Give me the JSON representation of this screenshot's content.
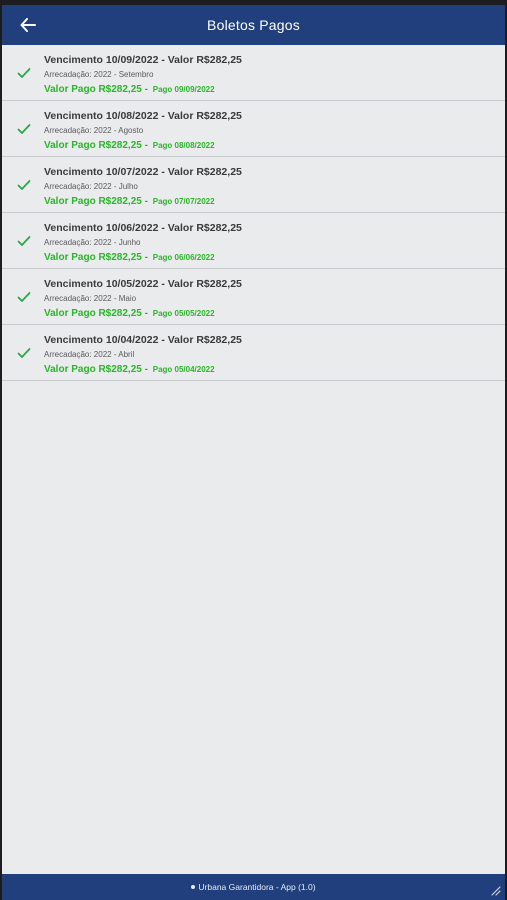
{
  "header": {
    "title": "Boletos Pagos",
    "back_icon": "arrow-left-icon"
  },
  "colors": {
    "header_bg": "#203f7c",
    "background": "#eaebed",
    "paid_green": "#2ab52a",
    "check_green": "#2aa844"
  },
  "items": [
    {
      "title": "Vencimento 10/09/2022 - Valor R$282,25",
      "subtitle": "Arrecadação: 2022 - Setembro",
      "paid_label": "Valor Pago R$282,25 -",
      "paid_date": "Pago 09/09/2022"
    },
    {
      "title": "Vencimento 10/08/2022 - Valor R$282,25",
      "subtitle": "Arrecadação: 2022 - Agosto",
      "paid_label": "Valor Pago R$282,25 -",
      "paid_date": "Pago 08/08/2022"
    },
    {
      "title": "Vencimento 10/07/2022 - Valor R$282,25",
      "subtitle": "Arrecadação: 2022 - Julho",
      "paid_label": "Valor Pago R$282,25 -",
      "paid_date": "Pago 07/07/2022"
    },
    {
      "title": "Vencimento 10/06/2022 - Valor R$282,25",
      "subtitle": "Arrecadação: 2022 - Junho",
      "paid_label": "Valor Pago R$282,25 -",
      "paid_date": "Pago 06/06/2022"
    },
    {
      "title": "Vencimento 10/05/2022 - Valor R$282,25",
      "subtitle": "Arrecadação: 2022 - Maio",
      "paid_label": "Valor Pago R$282,25 -",
      "paid_date": "Pago 05/05/2022"
    },
    {
      "title": "Vencimento 10/04/2022 - Valor R$282,25",
      "subtitle": "Arrecadação: 2022 - Abril",
      "paid_label": "Valor Pago R$282,25 -",
      "paid_date": "Pago 05/04/2022"
    }
  ],
  "footer": {
    "text": "Urbana Garantidora - App (1.0)"
  }
}
